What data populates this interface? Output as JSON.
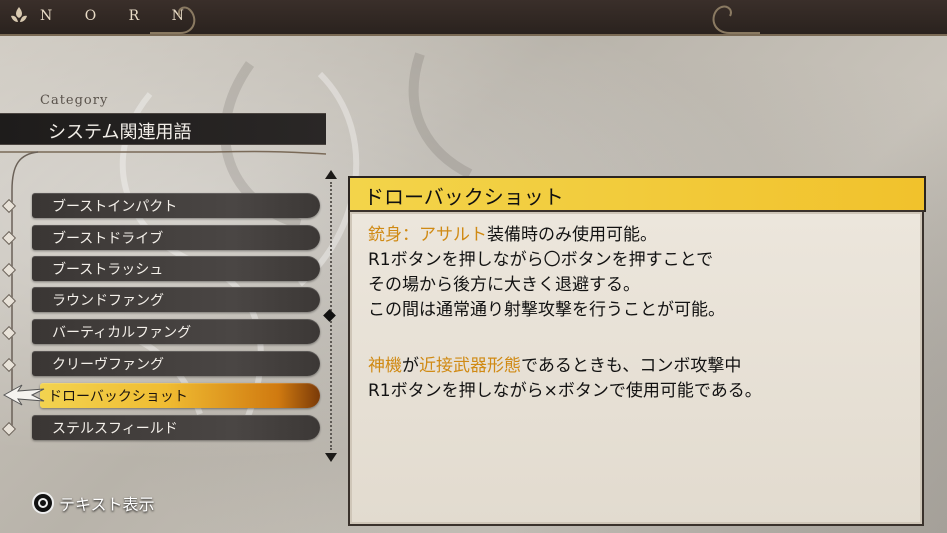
{
  "header": {
    "brand": "N O R N"
  },
  "category": {
    "label": "Category",
    "title": "システム関連用語"
  },
  "list": {
    "items": [
      {
        "label": "ブーストインパクト"
      },
      {
        "label": "ブーストドライブ"
      },
      {
        "label": "ブーストラッシュ"
      },
      {
        "label": "ラウンドファング"
      },
      {
        "label": "バーティカルファング"
      },
      {
        "label": "クリーヴファング"
      },
      {
        "label": "ドローバックショット"
      },
      {
        "label": "ステルスフィールド"
      }
    ],
    "selected_index": 6
  },
  "detail": {
    "title": "ドローバックショット",
    "line1": {
      "hl": "銃身：アサルト",
      "rest": "装備時のみ使用可能。"
    },
    "line2": "R1ボタンを押しながら〇ボタンを押すことで",
    "line3": "その場から後方に大きく退避する。",
    "line4": "この間は通常通り射撃攻撃を行うことが可能。",
    "line6": {
      "hl1": "神機",
      "mid1": "が",
      "hl2": "近接武器形態",
      "rest": "であるときも、コンボ攻撃中"
    },
    "line7": "R1ボタンを押しながら×ボタンで使用可能である。",
    "highlight_color": "#d08a14"
  },
  "footer": {
    "hint": "テキスト表示",
    "icon": "circle-button-icon"
  },
  "colors": {
    "accent_yellow": "#f1c22c",
    "dark_bar": "#2a2726"
  }
}
